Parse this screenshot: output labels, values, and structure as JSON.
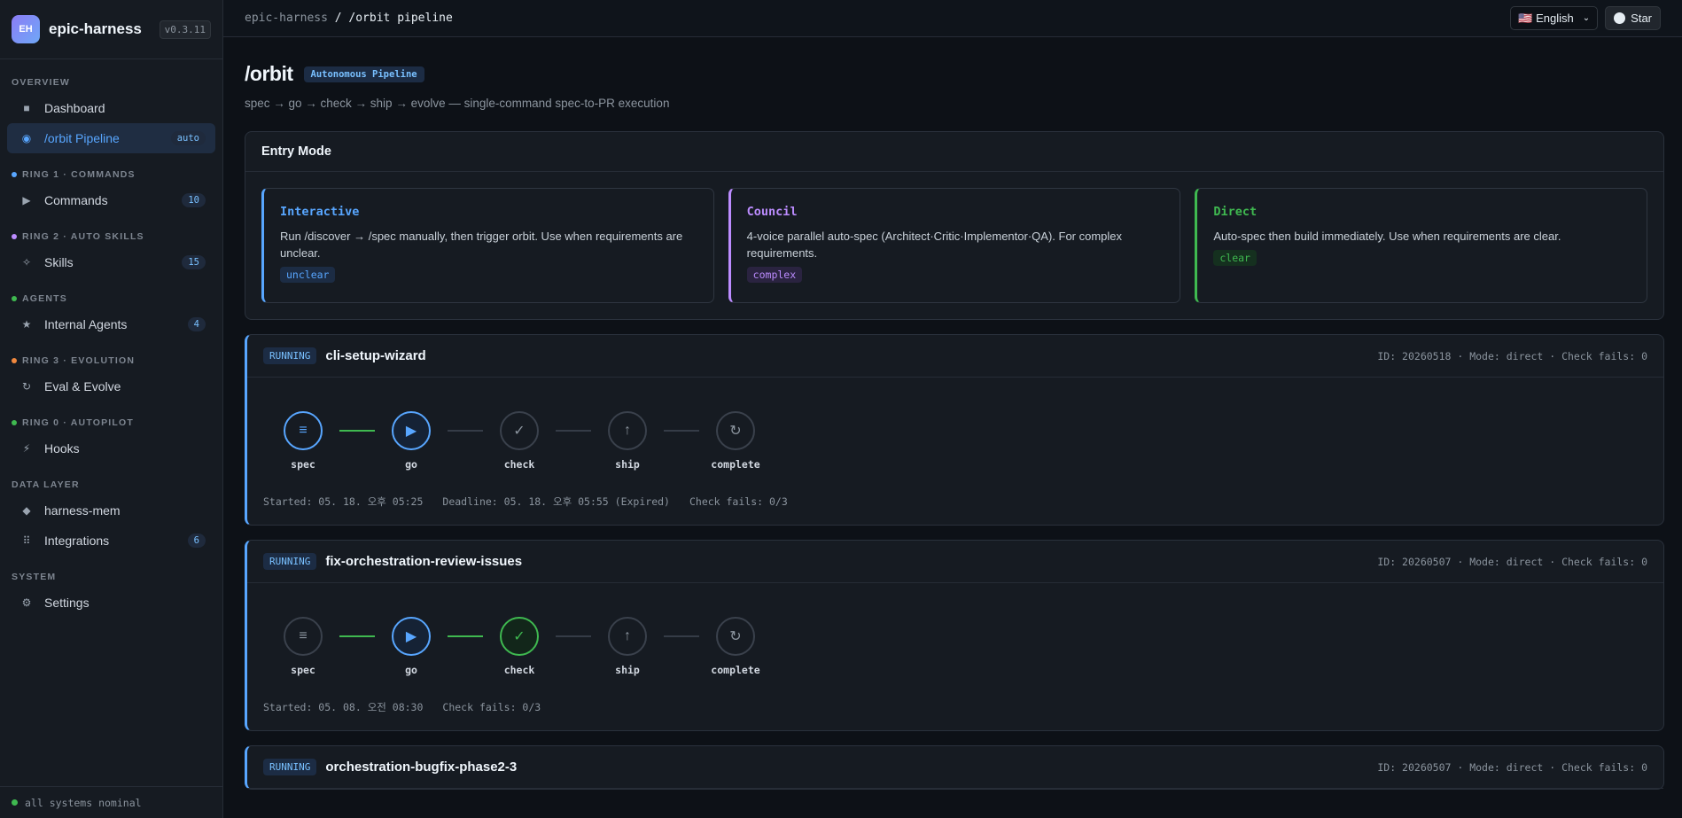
{
  "brand": {
    "logo": "EH",
    "name": "epic-harness",
    "version": "v0.3.11"
  },
  "sidebar": {
    "sections": [
      {
        "label": "OVERVIEW",
        "dot": "",
        "items": [
          {
            "label": "Dashboard",
            "icon": "■",
            "icon_name": "dashboard-icon",
            "count": ""
          },
          {
            "label": "/orbit Pipeline",
            "icon": "◉",
            "icon_name": "orbit-icon",
            "count": "auto",
            "active": true
          }
        ]
      },
      {
        "label": "RING 1 · COMMANDS",
        "dot": "#58a6ff",
        "items": [
          {
            "label": "Commands",
            "icon": "▶",
            "icon_name": "play-icon",
            "count": "10"
          }
        ]
      },
      {
        "label": "RING 2 · AUTO SKILLS",
        "dot": "#bc8cff",
        "items": [
          {
            "label": "Skills",
            "icon": "✧",
            "icon_name": "sparkle-icon",
            "count": "15"
          }
        ]
      },
      {
        "label": "AGENTS",
        "dot": "#3fb950",
        "items": [
          {
            "label": "Internal Agents",
            "icon": "★",
            "icon_name": "star-icon",
            "count": "4"
          }
        ]
      },
      {
        "label": "RING 3 · EVOLUTION",
        "dot": "#f0883e",
        "items": [
          {
            "label": "Eval & Evolve",
            "icon": "↻",
            "icon_name": "refresh-icon",
            "count": ""
          }
        ]
      },
      {
        "label": "RING 0 · AUTOPILOT",
        "dot": "#3fb950",
        "items": [
          {
            "label": "Hooks",
            "icon": "⚡",
            "icon_name": "lightning-icon",
            "count": ""
          }
        ]
      },
      {
        "label": "DATA LAYER",
        "dot": "",
        "items": [
          {
            "label": "harness-mem",
            "icon": "◆",
            "icon_name": "diamond-icon",
            "count": ""
          },
          {
            "label": "Integrations",
            "icon": "⠿",
            "icon_name": "grid-icon",
            "count": "6"
          }
        ]
      },
      {
        "label": "SYSTEM",
        "dot": "",
        "items": [
          {
            "label": "Settings",
            "icon": "⚙",
            "icon_name": "gear-icon",
            "count": ""
          }
        ]
      }
    ],
    "footer": "all systems nominal"
  },
  "topbar": {
    "crumb_root": "epic-harness",
    "crumb_sep": " / ",
    "crumb_current": "/orbit pipeline",
    "language": "🇺🇸 English",
    "star": "Star"
  },
  "page": {
    "title": "/orbit",
    "badge": "Autonomous Pipeline",
    "subtitle": "spec → go → check → ship → evolve — single-command spec-to-PR execution"
  },
  "entry_mode": {
    "title": "Entry Mode",
    "modes": [
      {
        "title": "Interactive",
        "desc": "Run /discover → /spec manually, then trigger orbit. Use when requirements are unclear.",
        "tag": "unclear",
        "color": "#58a6ff",
        "tag_bg": "#1c2c44"
      },
      {
        "title": "Council",
        "desc": "4-voice parallel auto-spec (Architect·Critic·Implementor·QA). For complex requirements.",
        "tag": "complex",
        "color": "#bc8cff",
        "tag_bg": "#2a2340"
      },
      {
        "title": "Direct",
        "desc": "Auto-spec then build immediately. Use when requirements are clear.",
        "tag": "clear",
        "color": "#3fb950",
        "tag_bg": "#15301f"
      }
    ]
  },
  "runs": [
    {
      "status": "RUNNING",
      "name": "cli-setup-wizard",
      "meta": "ID: 20260518 · Mode: direct · Check fails: 0",
      "stages": [
        {
          "label": "spec",
          "icon": "≡",
          "state": "done"
        },
        {
          "label": "go",
          "icon": "▶",
          "state": "active"
        },
        {
          "label": "check",
          "icon": "✓",
          "state": "idle"
        },
        {
          "label": "ship",
          "icon": "↑",
          "state": "idle"
        },
        {
          "label": "complete",
          "icon": "↻",
          "state": "idle"
        }
      ],
      "connectors": [
        "green",
        "",
        "",
        ""
      ],
      "footer": [
        "Started: 05. 18. 오후 05:25",
        "Deadline: 05. 18. 오후 05:55 (Expired)",
        "Check fails: 0/3"
      ]
    },
    {
      "status": "RUNNING",
      "name": "fix-orchestration-review-issues",
      "meta": "ID: 20260507 · Mode: direct · Check fails: 0",
      "stages": [
        {
          "label": "spec",
          "icon": "≡",
          "state": "idle"
        },
        {
          "label": "go",
          "icon": "▶",
          "state": "active"
        },
        {
          "label": "check",
          "icon": "✓",
          "state": "ok"
        },
        {
          "label": "ship",
          "icon": "↑",
          "state": "idle"
        },
        {
          "label": "complete",
          "icon": "↻",
          "state": "idle"
        }
      ],
      "connectors": [
        "green",
        "green",
        "",
        ""
      ],
      "footer": [
        "Started: 05. 08. 오전 08:30",
        "Check fails: 0/3"
      ]
    },
    {
      "status": "RUNNING",
      "name": "orchestration-bugfix-phase2-3",
      "meta": "ID: 20260507 · Mode: direct · Check fails: 0",
      "stages": [],
      "connectors": [],
      "footer": []
    }
  ]
}
